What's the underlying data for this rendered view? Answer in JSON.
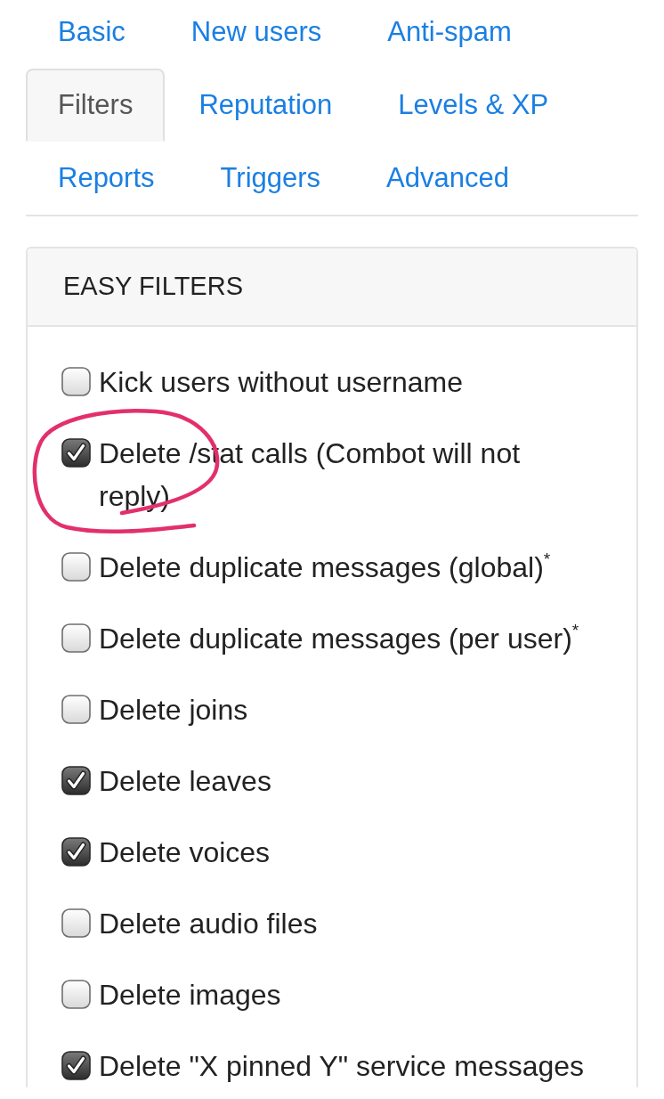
{
  "tabs": [
    {
      "label": "Basic",
      "selected": false
    },
    {
      "label": "New users",
      "selected": false
    },
    {
      "label": "Anti-spam",
      "selected": false
    },
    {
      "label": "Filters",
      "selected": true
    },
    {
      "label": "Reputation",
      "selected": false
    },
    {
      "label": "Levels & XP",
      "selected": false
    },
    {
      "label": "Reports",
      "selected": false
    },
    {
      "label": "Triggers",
      "selected": false
    },
    {
      "label": "Advanced",
      "selected": false
    }
  ],
  "panel": {
    "title": "EASY FILTERS",
    "filters": [
      {
        "label": "Kick users without username",
        "checked": false,
        "circled": false
      },
      {
        "label": "Delete /stat calls (Combot will not reply)",
        "checked": true,
        "circled": true
      },
      {
        "label": "Delete duplicate messages (global)$^{*}$",
        "checked": false,
        "circled": false
      },
      {
        "label": "Delete duplicate messages (per user)$^{*}$",
        "checked": false,
        "circled": false
      },
      {
        "label": "Delete joins",
        "checked": false,
        "circled": false
      },
      {
        "label": "Delete leaves",
        "checked": true,
        "circled": false
      },
      {
        "label": "Delete voices",
        "checked": true,
        "circled": false
      },
      {
        "label": "Delete audio files",
        "checked": false,
        "circled": false
      },
      {
        "label": "Delete images",
        "checked": false,
        "circled": false
      },
      {
        "label": "Delete \"X pinned Y\" service messages",
        "checked": true,
        "circled": false
      }
    ]
  }
}
